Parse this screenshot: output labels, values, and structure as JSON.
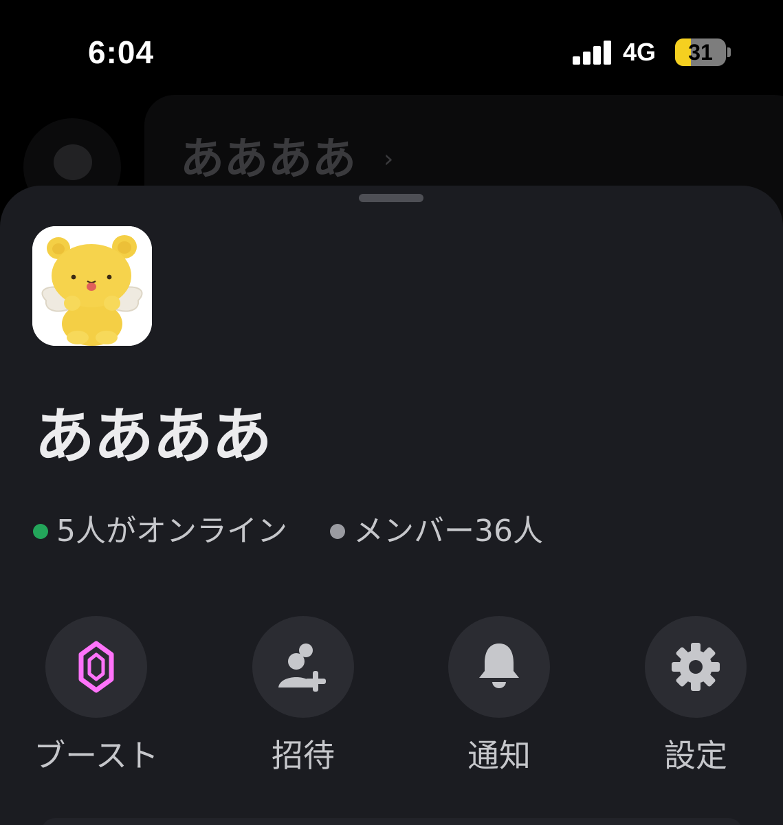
{
  "status_bar": {
    "time": "6:04",
    "network": "4G",
    "battery_percent": "31",
    "battery_level": 0.31,
    "battery_color": "#f5d020",
    "signal_bars": 4
  },
  "background": {
    "channel_title": "ああああ",
    "chevron": "›"
  },
  "sheet": {
    "server_name": "ああああ",
    "server_icon": "kero-plush-bear-image",
    "online_text": "5人がオンライン",
    "online_dot_color": "#23a55a",
    "members_text": "メンバー36人",
    "members_dot_color": "#9a9ba1",
    "actions": [
      {
        "label": "ブースト",
        "icon": "boost-gem-icon",
        "icon_color": "#ff73fa"
      },
      {
        "label": "招待",
        "icon": "invite-user-icon",
        "icon_color": "#c6c7cb"
      },
      {
        "label": "通知",
        "icon": "bell-icon",
        "icon_color": "#c6c7cb"
      },
      {
        "label": "設定",
        "icon": "gear-icon",
        "icon_color": "#c6c7cb"
      }
    ]
  }
}
